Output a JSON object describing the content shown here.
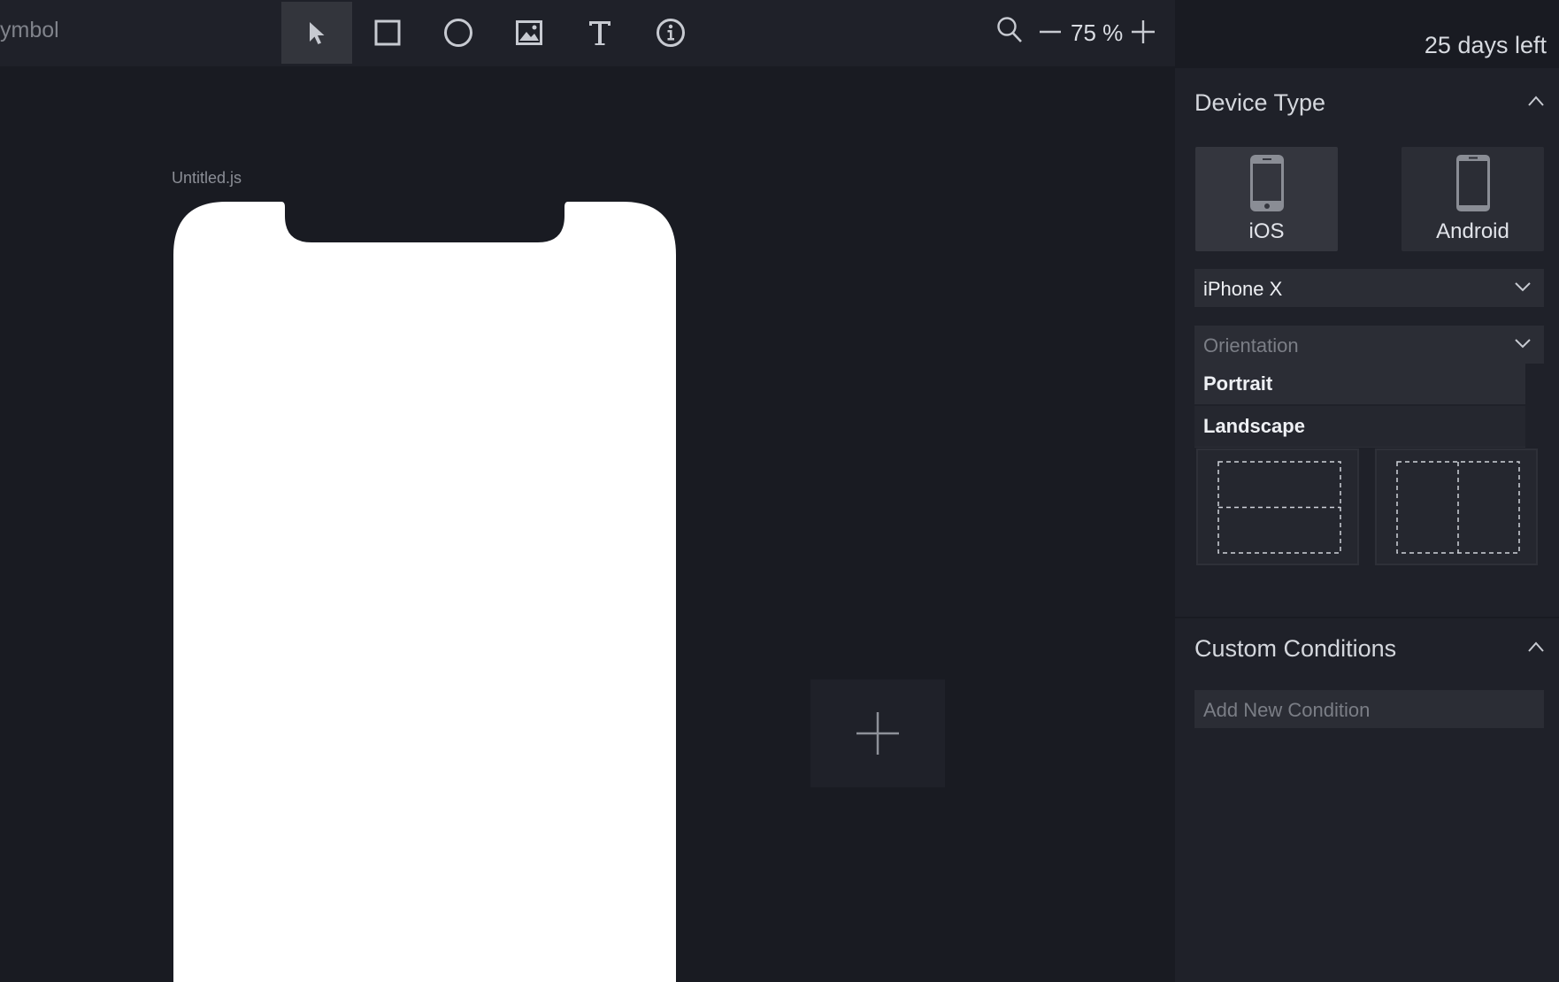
{
  "toolbar": {
    "app_title": "ymbol",
    "tools": [
      {
        "icon": "cursor-arrow-icon",
        "active": true
      },
      {
        "icon": "rectangle-icon"
      },
      {
        "icon": "ellipse-icon"
      },
      {
        "icon": "image-icon"
      },
      {
        "icon": "text-icon"
      },
      {
        "icon": "info-icon"
      }
    ],
    "zoom": {
      "level": "75 %",
      "search_icon": "search-icon",
      "minus_icon": "minus-icon",
      "plus_icon": "plus-icon"
    }
  },
  "canvas": {
    "file_name": "Untitled.js",
    "add_artboard_icon": "plus-icon"
  },
  "panel": {
    "trial": "25 days left",
    "device_type": {
      "title": "Device Type",
      "devices": [
        {
          "label": "iOS",
          "selected": true
        },
        {
          "label": "Android",
          "selected": false
        }
      ],
      "model": {
        "value": "iPhone X"
      },
      "orientation": {
        "placeholder": "Orientation",
        "options": [
          "Portrait",
          "Landscape"
        ]
      }
    },
    "custom_conditions": {
      "title": "Custom Conditions",
      "placeholder": "Add New Condition"
    }
  },
  "colors": {
    "background": "#191b22",
    "panel": "#1f2129",
    "control": "#2b2d35",
    "accent_text": "#eef0f4"
  }
}
